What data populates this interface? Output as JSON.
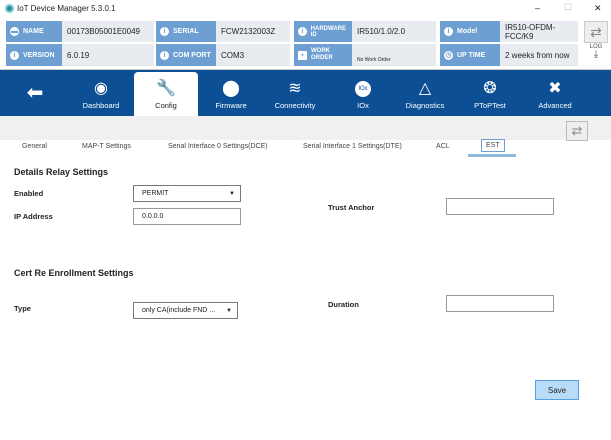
{
  "window": {
    "title": "IoT Device Manager 5.3.0.1",
    "min": "–",
    "max": "☐",
    "close": "✕"
  },
  "info": {
    "name_label": "NAME",
    "name": "00173B05001E0049",
    "serial_label": "SERIAL",
    "serial": "FCW2132003Z",
    "hw_label": "HARDWARE ID",
    "hw": "IR510/1.0/2.0",
    "model_label": "Model",
    "model": "IR510-OFDM-FCC/K9",
    "version_label": "VERSION",
    "version": "6.0.19",
    "comport_label": "COM PORT",
    "comport": "COM3",
    "workorder_label": "WORK ORDER",
    "workorder": "No Work Order",
    "uptime_label": "UP TIME",
    "uptime": "2 weeks from now",
    "log_label": "LOG"
  },
  "nav": [
    {
      "label": "Dashboard"
    },
    {
      "label": "Config"
    },
    {
      "label": "Firmware"
    },
    {
      "label": "Connectivity"
    },
    {
      "label": "IOx"
    },
    {
      "label": "Diagnostics"
    },
    {
      "label": "PToPTest"
    },
    {
      "label": "Advanced"
    }
  ],
  "tabs": [
    "General",
    "MAP-T Settings",
    "Serial Interface 0 Settings(DCE)",
    "Serial Interface 1 Settings(DTE)",
    "ACL",
    "EST"
  ],
  "relay": {
    "title": "Details Relay Settings",
    "enabled_label": "Enabled",
    "enabled": "PERMIT",
    "ip_label": "IP Address",
    "ip": "0.0.0.0",
    "trust_label": "Trust Anchor",
    "trust": ""
  },
  "cert": {
    "title": "Cert Re Enrollment Settings",
    "type_label": "Type",
    "type": "only CA(include FND ...",
    "duration_label": "Duration",
    "duration": ""
  },
  "save": "Save"
}
